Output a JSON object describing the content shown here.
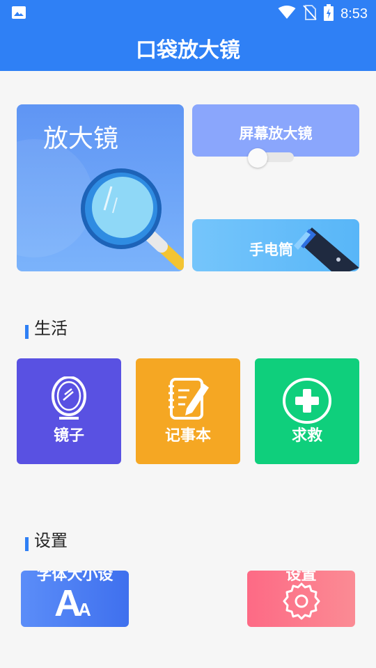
{
  "status_bar": {
    "time": "8:53",
    "icons": [
      "image-icon",
      "wifi-icon",
      "no-sim-icon",
      "battery-charging-icon"
    ]
  },
  "app_bar": {
    "title": "口袋放大镜"
  },
  "feature_cards": {
    "magnifier": {
      "label": "放大镜",
      "icon": "magnifier-icon"
    },
    "screen_magnifier": {
      "label": "屏幕放大镜",
      "toggle_on": false
    },
    "flashlight": {
      "label": "手电筒",
      "icon": "flashlight-icon"
    }
  },
  "sections": {
    "life": {
      "title": "生活",
      "tiles": [
        {
          "label": "镜子",
          "icon": "mirror-icon",
          "color": "#5951e2"
        },
        {
          "label": "记事本",
          "icon": "notebook-icon",
          "color": "#f5a723"
        },
        {
          "label": "求救",
          "icon": "sos-plus-icon",
          "color": "#0fcf7c"
        }
      ]
    },
    "settings": {
      "title": "设置",
      "cards": [
        {
          "label": "字体大小设",
          "icon": "font-size-icon"
        },
        {
          "label": "设置",
          "icon": "gear-icon"
        }
      ]
    }
  },
  "colors": {
    "primary": "#2f80f5",
    "background": "#f6f6f6"
  }
}
